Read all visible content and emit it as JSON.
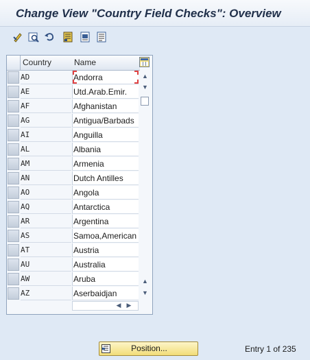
{
  "title": "Change View \"Country Field Checks\": Overview",
  "toolbar": {
    "icons": [
      "change-icon",
      "details-icon",
      "undo-change-icon",
      "select-all-icon",
      "select-block-icon",
      "deselect-all-icon"
    ]
  },
  "table": {
    "col_country": "Country",
    "col_name": "Name",
    "rows": [
      {
        "code": "AD",
        "name": "Andorra"
      },
      {
        "code": "AE",
        "name": "Utd.Arab.Emir."
      },
      {
        "code": "AF",
        "name": "Afghanistan"
      },
      {
        "code": "AG",
        "name": "Antigua/Barbads"
      },
      {
        "code": "AI",
        "name": "Anguilla"
      },
      {
        "code": "AL",
        "name": "Albania"
      },
      {
        "code": "AM",
        "name": "Armenia"
      },
      {
        "code": "AN",
        "name": "Dutch Antilles"
      },
      {
        "code": "AO",
        "name": "Angola"
      },
      {
        "code": "AQ",
        "name": "Antarctica"
      },
      {
        "code": "AR",
        "name": "Argentina"
      },
      {
        "code": "AS",
        "name": "Samoa,American"
      },
      {
        "code": "AT",
        "name": "Austria"
      },
      {
        "code": "AU",
        "name": "Australia"
      },
      {
        "code": "AW",
        "name": "Aruba"
      },
      {
        "code": "AZ",
        "name": "Aserbaidjan"
      }
    ]
  },
  "position_button": "Position...",
  "entry_text": "Entry 1 of 235",
  "colors": {
    "background": "#dfe9f5",
    "button": "#f2dd79"
  }
}
